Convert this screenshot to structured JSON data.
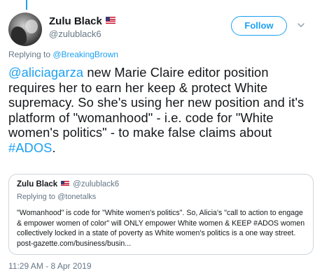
{
  "author": {
    "display_name": "Zulu Black",
    "handle": "@zulublack6"
  },
  "follow_button": {
    "label": "Follow"
  },
  "replying": {
    "prefix": "Replying to ",
    "target": "@BreakingBrown"
  },
  "tweet": {
    "mention": "@aliciagarza",
    "text_1": " new Marie Claire editor position requires her to earn her keep & protect White supremacy. So she's using her new position and it's platform of \"womanhood\" - i.e. code for \"White women's politics\" - to make false claims about ",
    "hashtag": "#ADOS",
    "text_2": "."
  },
  "quoted_tweet": {
    "display_name": "Zulu Black",
    "handle": "@zulublack6",
    "replying_prefix": "Replying to ",
    "replying_target": "@tonetalks",
    "text": "\"Womanhood\" is code for \"White women's politics\". So, Alicia's \"call to action to engage & empower women of color\" will ONLY empower White women & KEEP #ADOS women collectively locked in a state of poverty as White women's politics is a one way street. post-gazette.com/business/busin..."
  },
  "timestamp": "11:29 AM - 8 Apr 2019",
  "icons": {
    "flag": "us-flag-icon",
    "menu": "chevron-down-icon"
  },
  "colors": {
    "accent": "#1da1f2",
    "secondary_text": "#657786",
    "border": "#ccd6dd"
  }
}
